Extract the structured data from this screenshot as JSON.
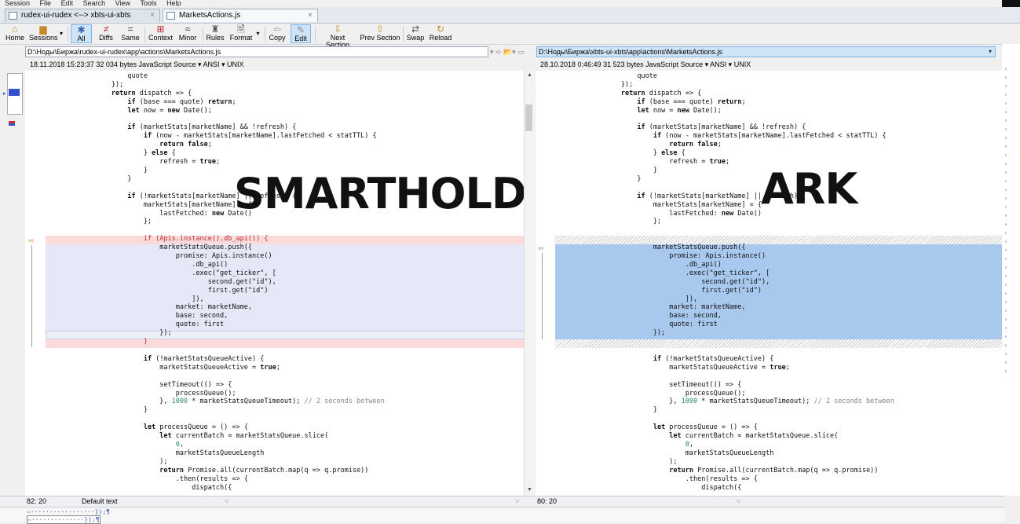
{
  "menu": [
    "Session",
    "File",
    "Edit",
    "Search",
    "View",
    "Tools",
    "Help"
  ],
  "tabs": [
    {
      "label": "rudex-ui-rudex <--> xbts-ui-xbts"
    },
    {
      "label": "MarketsActions.js"
    }
  ],
  "toolbar": {
    "home": "Home",
    "sessions": "Sessions",
    "all": "All",
    "diffs": "Diffs",
    "same": "Same",
    "context": "Context",
    "minor": "Minor",
    "rules": "Rules",
    "format": "Format",
    "copy": "Copy",
    "edit": "Edit",
    "next_section": "Next Section",
    "prev_section": "Prev Section",
    "swap": "Swap",
    "reload": "Reload"
  },
  "left": {
    "path": "D:\\Ноды\\Биржа\\rudex-ui-rudex\\app\\actions\\MarketsActions.js",
    "info": "18.11.2018 15:23:37   32 034 bytes   JavaScript Source  ▾  ANSI  ▾  UNIX",
    "status_pos": "82: 20",
    "status_text": "Default text",
    "watermark": "SMARTHOLDEM"
  },
  "right": {
    "path": "D:\\Ноды\\Биржа\\xbts-ui-xbts\\app\\actions\\MarketsActions.js",
    "info": "28.10.2018 0:46:49   31 523 bytes   JavaScript Source  ▾  ANSI  ▾  UNIX",
    "status_pos": "80: 20",
    "watermark": "ARK"
  },
  "bottom": {
    "line1": "⇨·················});¶",
    "line2": "⇦··············});¶"
  },
  "colors": {
    "removed": "#fbdada",
    "changed": "#e7e8f7",
    "selected": "#a8c8ee",
    "accent": "#cfe3f7"
  }
}
